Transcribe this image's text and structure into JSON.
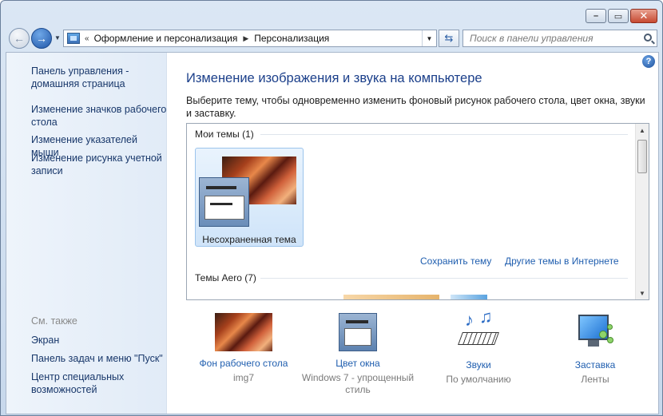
{
  "navbar": {
    "address_chevron": "«",
    "breadcrumb": [
      "Оформление и персонализация",
      "Персонализация"
    ],
    "search_placeholder": "Поиск в панели управления"
  },
  "sidebar": {
    "items": [
      {
        "label": "Панель управления - домашняя страница"
      },
      {
        "label": "Изменение значков рабочего стола"
      },
      {
        "label": "Изменение указателей мыши"
      },
      {
        "label": "Изменение рисунка учетной записи"
      }
    ],
    "see_also_heading": "См. также",
    "see_also": [
      {
        "label": "Экран"
      },
      {
        "label": "Панель задач и меню \"Пуск\""
      },
      {
        "label": "Центр специальных возможностей"
      }
    ]
  },
  "main": {
    "title": "Изменение изображения и звука на компьютере",
    "description": "Выберите тему, чтобы одновременно изменить фоновый рисунок рабочего стола, цвет окна, звуки и заставку.",
    "groups": {
      "my_themes": "Мои темы (1)",
      "aero_themes": "Темы Aero (7)"
    },
    "theme_tile_label": "Несохраненная тема",
    "save_theme_link": "Сохранить тему",
    "online_themes_link": "Другие темы в Интернете"
  },
  "bottom": [
    {
      "title": "Фон рабочего стола",
      "sub": "img7",
      "icon": "wallpaper-icon"
    },
    {
      "title": "Цвет окна",
      "sub": "Windows 7 - упрощенный стиль",
      "icon": "window-color-icon"
    },
    {
      "title": "Звуки",
      "sub": "По умолчанию",
      "icon": "sounds-icon"
    },
    {
      "title": "Заставка",
      "sub": "Ленты",
      "icon": "screensaver-icon"
    }
  ],
  "colors": {
    "link": "#1f5eaf",
    "title": "#1b3f8a",
    "highlight": "#b11d1d"
  }
}
